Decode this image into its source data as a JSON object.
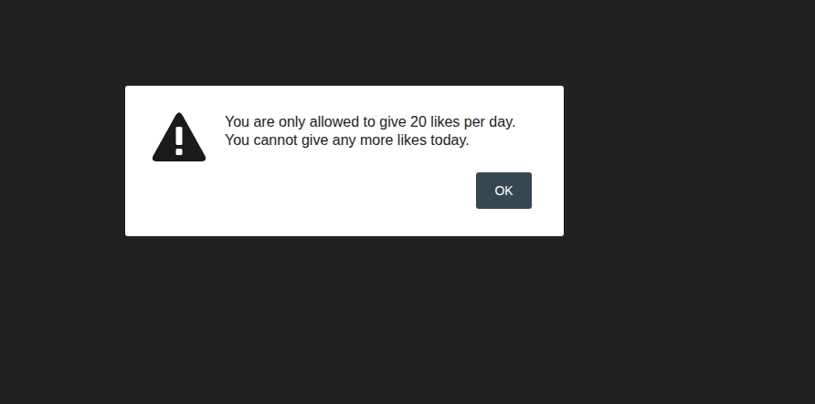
{
  "dialog": {
    "message": [
      "You are only allowed to give 20 likes per day.",
      "You cannot give any more likes today."
    ],
    "buttons": [
      "OK"
    ]
  }
}
